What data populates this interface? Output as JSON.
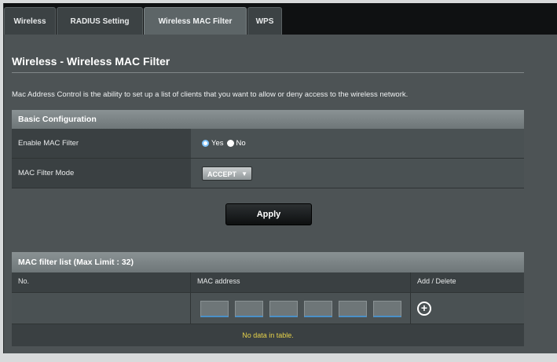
{
  "tabs": [
    {
      "label": "Wireless"
    },
    {
      "label": "RADIUS Setting"
    },
    {
      "label": "Wireless MAC Filter"
    },
    {
      "label": "WPS"
    }
  ],
  "page": {
    "title": "Wireless - Wireless MAC Filter",
    "description": "Mac Address Control is the ability to set up a list of clients that you want to allow or deny access to the wireless network."
  },
  "basic_config": {
    "header": "Basic Configuration",
    "enable_label": "Enable MAC Filter",
    "yes_label": "Yes",
    "no_label": "No",
    "enable_value": "Yes",
    "mode_label": "MAC Filter Mode",
    "mode_value": "ACCEPT"
  },
  "apply_label": "Apply",
  "mac_list": {
    "header": "MAC filter list (Max Limit : 32)",
    "col_no": "No.",
    "col_mac": "MAC address",
    "col_add": "Add / Delete",
    "empty_text": "No data in table."
  },
  "colors": {
    "background": "#4d5355",
    "header": "#7b8386",
    "empty_text": "#e6d24a"
  }
}
